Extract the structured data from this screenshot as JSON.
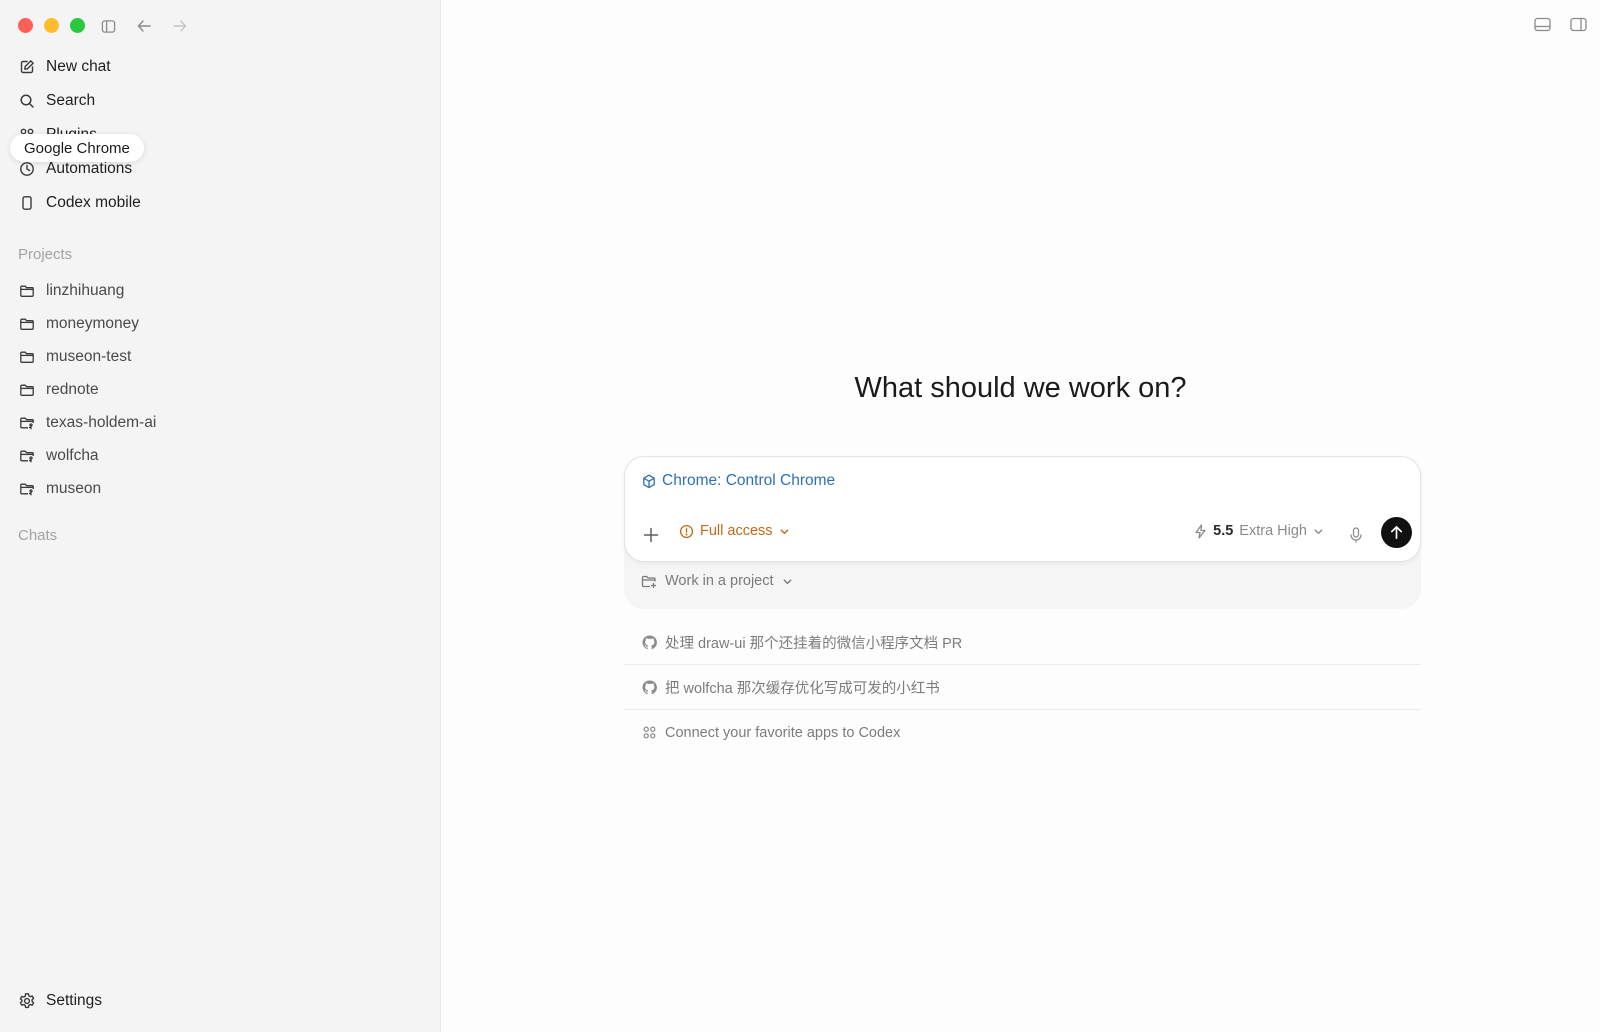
{
  "sidebar": {
    "nav": [
      {
        "label": "New chat",
        "icon": "compose-icon"
      },
      {
        "label": "Search",
        "icon": "search-icon"
      },
      {
        "label": "Plugins",
        "icon": "grid-icon"
      },
      {
        "label": "Automations",
        "icon": "clock-icon"
      },
      {
        "label": "Codex mobile",
        "icon": "phone-icon"
      }
    ],
    "tooltip": "Google Chrome",
    "projects_label": "Projects",
    "projects": [
      {
        "label": "linzhihuang",
        "icon": "folder-icon"
      },
      {
        "label": "moneymoney",
        "icon": "folder-icon"
      },
      {
        "label": "museon-test",
        "icon": "folder-icon"
      },
      {
        "label": "rednote",
        "icon": "folder-icon"
      },
      {
        "label": "texas-holdem-ai",
        "icon": "folder-branch-icon"
      },
      {
        "label": "wolfcha",
        "icon": "folder-branch-icon"
      },
      {
        "label": "museon",
        "icon": "folder-branch-icon"
      }
    ],
    "chats_label": "Chats",
    "settings_label": "Settings"
  },
  "main": {
    "headline": "What should we work on?",
    "composer": {
      "chip_label": "Chrome: Control Chrome",
      "access_label": "Full access",
      "model_version": "5.5",
      "model_effort": "Extra High",
      "project_label": "Work in a project"
    },
    "suggestions": [
      {
        "label": "处理 draw-ui 那个还挂着的微信小程序文档 PR",
        "icon": "github-icon"
      },
      {
        "label": "把 wolfcha 那次缓存优化写成可发的小红书",
        "icon": "github-icon"
      },
      {
        "label": "Connect your favorite apps to Codex",
        "icon": "apps-icon"
      }
    ]
  },
  "colors": {
    "accent_blue": "#2f6fb5",
    "warning_orange": "#c26a1a",
    "sidebar_bg": "#f4f4f4",
    "send_button": "#111111"
  }
}
